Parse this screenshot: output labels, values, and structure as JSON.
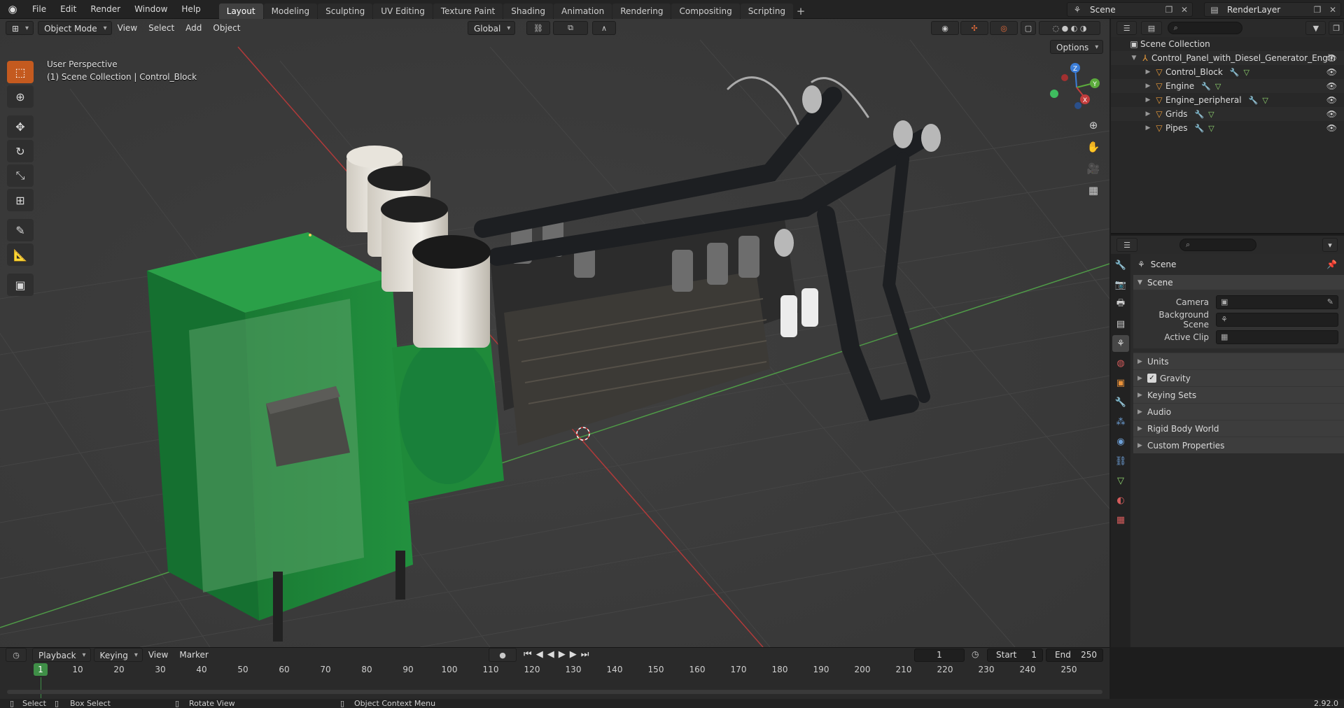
{
  "topbar": {
    "menus": [
      "File",
      "Edit",
      "Render",
      "Window",
      "Help"
    ],
    "workspaces": [
      "Layout",
      "Modeling",
      "Sculpting",
      "UV Editing",
      "Texture Paint",
      "Shading",
      "Animation",
      "Rendering",
      "Compositing",
      "Scripting"
    ],
    "active_workspace": "Layout",
    "scene_name": "Scene",
    "view_layer": "RenderLayer"
  },
  "viewport": {
    "mode": "Object Mode",
    "menus": [
      "View",
      "Select",
      "Add",
      "Object"
    ],
    "transform_orientation": "Global",
    "options_label": "Options",
    "perspective_label": "User Perspective",
    "context_label": "(1) Scene Collection | Control_Block",
    "gizmo_axes": {
      "x": "X",
      "y": "Y",
      "z": "Z"
    }
  },
  "outliner": {
    "root": "Scene Collection",
    "collection": "Control_Panel_with_Diesel_Generator_Engin",
    "objects": [
      "Control_Block",
      "Engine",
      "Engine_peripheral",
      "Grids",
      "Pipes"
    ]
  },
  "properties": {
    "context_title": "Scene",
    "panel_title": "Scene",
    "fields": [
      {
        "label": "Camera"
      },
      {
        "label": "Background Scene"
      },
      {
        "label": "Active Clip"
      }
    ],
    "subpanels": [
      "Units",
      "Gravity",
      "Keying Sets",
      "Audio",
      "Rigid Body World",
      "Custom Properties"
    ],
    "gravity_checked": true
  },
  "timeline": {
    "menus": [
      "Playback",
      "Keying",
      "View",
      "Marker"
    ],
    "current_frame": "1",
    "start_label": "Start",
    "start_value": "1",
    "end_label": "End",
    "end_value": "250",
    "ruler_marks": [
      "1",
      "10",
      "20",
      "30",
      "40",
      "50",
      "60",
      "70",
      "80",
      "90",
      "100",
      "110",
      "120",
      "130",
      "140",
      "150",
      "160",
      "170",
      "180",
      "190",
      "200",
      "210",
      "220",
      "230",
      "240",
      "250"
    ]
  },
  "statusbar": {
    "select": "Select",
    "box_select": "Box Select",
    "rotate_view": "Rotate View",
    "context_menu": "Object Context Menu",
    "version": "2.92.0"
  },
  "colors": {
    "accent_orange": "#c45a1f",
    "generator_green": "#1f8a3a",
    "x_axis": "#c33c3c",
    "y_axis": "#5cab3c",
    "z_axis": "#3b7dd8"
  }
}
